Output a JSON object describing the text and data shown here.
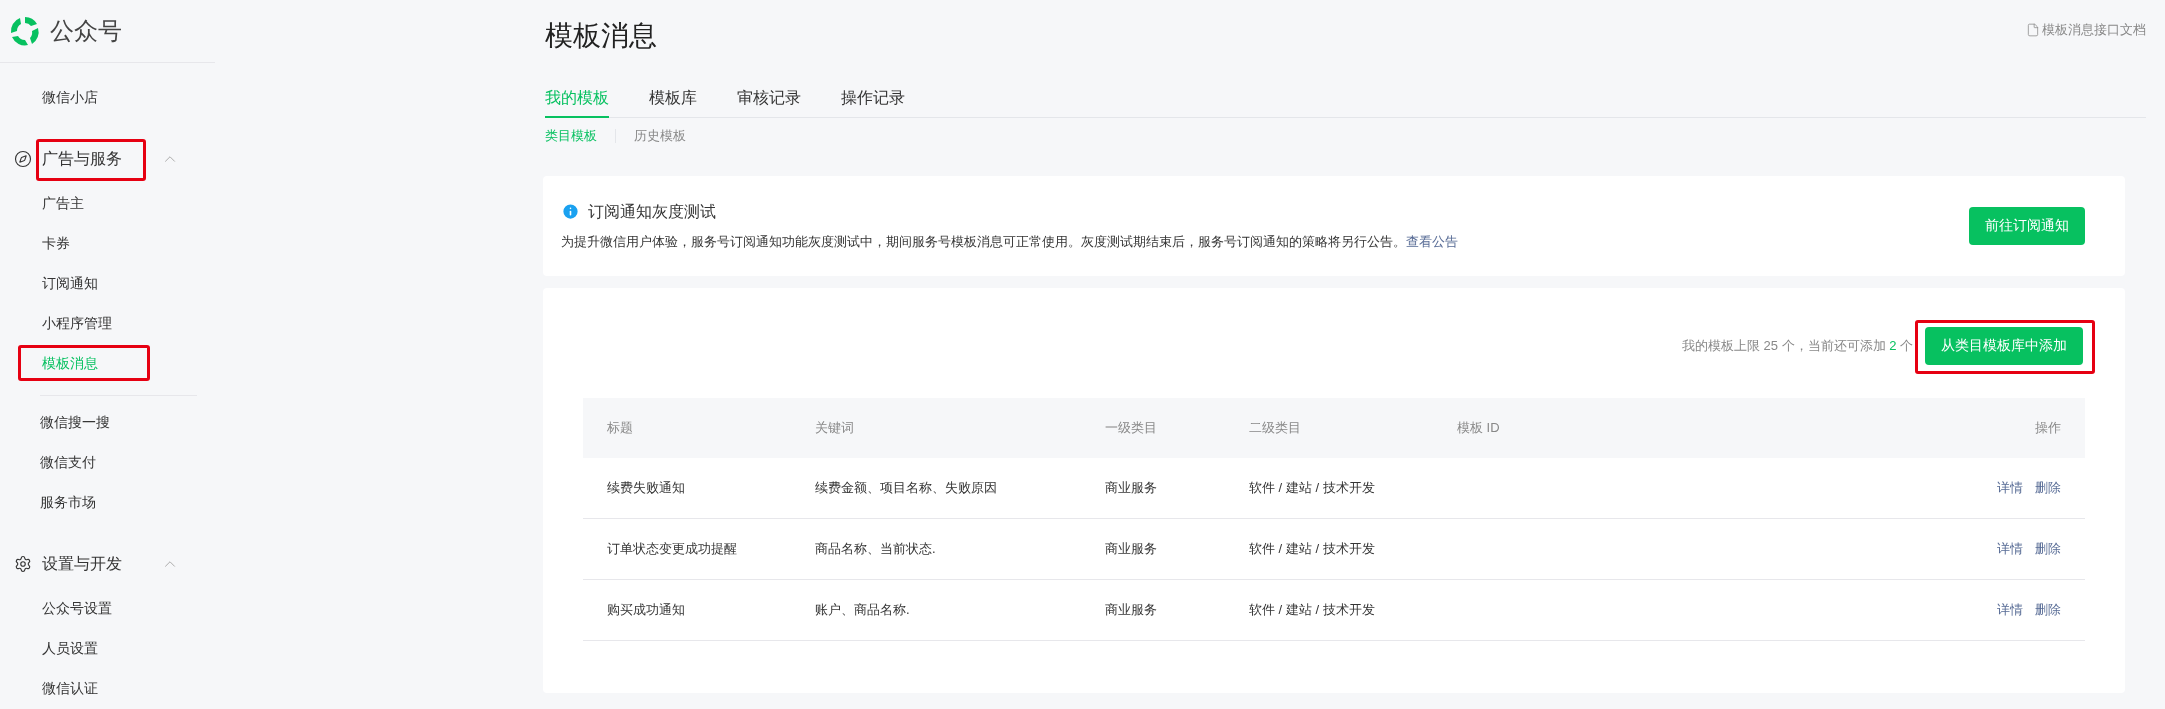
{
  "sidebar": {
    "logo_text": "公众号",
    "groups": [
      {
        "items": [
          {
            "label": "微信小店",
            "selected": false
          }
        ]
      },
      {
        "title": "广告与服务",
        "expanded": true,
        "annotated": true,
        "items": [
          {
            "label": "广告主",
            "selected": false
          },
          {
            "label": "卡券",
            "selected": false
          },
          {
            "label": "订阅通知",
            "selected": false
          },
          {
            "label": "小程序管理",
            "selected": false
          },
          {
            "label": "模板消息",
            "selected": true,
            "annotated": true
          }
        ]
      },
      {
        "items": [
          {
            "label": "微信搜一搜",
            "selected": false
          },
          {
            "label": "微信支付",
            "selected": false
          },
          {
            "label": "服务市场",
            "selected": false
          }
        ]
      },
      {
        "title": "设置与开发",
        "expanded": true,
        "items": [
          {
            "label": "公众号设置",
            "selected": false
          },
          {
            "label": "人员设置",
            "selected": false
          },
          {
            "label": "微信认证",
            "selected": false
          }
        ]
      }
    ]
  },
  "page": {
    "title": "模板消息",
    "doc_link": "模板消息接口文档",
    "tabs": [
      {
        "label": "我的模板",
        "selected": true
      },
      {
        "label": "模板库",
        "selected": false
      },
      {
        "label": "审核记录",
        "selected": false
      },
      {
        "label": "操作记录",
        "selected": false
      }
    ],
    "subtabs": [
      {
        "label": "类目模板",
        "selected": true
      },
      {
        "label": "历史模板",
        "selected": false
      }
    ]
  },
  "notice": {
    "title": "订阅通知灰度测试",
    "text": "为提升微信用户体验，服务号订阅通知功能灰度测试中，期间服务号模板消息可正常使用。灰度测试期结束后，服务号订阅通知的策略将另行公告。",
    "link": "查看公告",
    "button": "前往订阅通知"
  },
  "templates": {
    "quota_prefix": "我的模板上限 25 个，当前还可添加",
    "quota_count": "2",
    "quota_suffix": "个",
    "add_button": {
      "label": "从类目模板库中添加",
      "annotated": true
    },
    "columns": [
      "标题",
      "关键词",
      "一级类目",
      "二级类目",
      "模板 ID",
      "操作"
    ],
    "rows": [
      {
        "title": "续费失败通知",
        "keywords": "续费金额、项目名称、失败原因",
        "category_1": "商业服务",
        "category_2": "软件 / 建站 / 技术开发",
        "actions": [
          "详情",
          "删除"
        ]
      },
      {
        "title": "订单状态变更成功提醒",
        "keywords": "商品名称、当前状态.",
        "category_1": "商业服务",
        "category_2": "软件 / 建站 / 技术开发",
        "actions": [
          "详情",
          "删除"
        ]
      },
      {
        "title": "购买成功通知",
        "keywords": "账户、商品名称.",
        "category_1": "商业服务",
        "category_2": "软件 / 建站 / 技术开发",
        "actions": [
          "详情",
          "删除"
        ]
      }
    ]
  }
}
